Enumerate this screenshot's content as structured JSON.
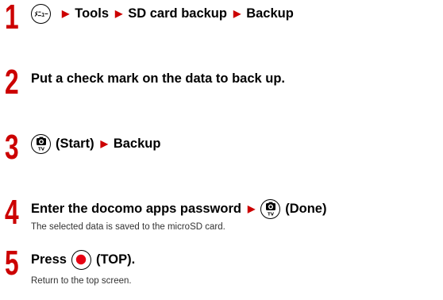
{
  "steps": [
    {
      "number": "1",
      "icon": "menu-key-icon",
      "key_label": "ﾒﾆｭｰ",
      "items": [
        "Tools",
        "SD card backup",
        "Backup"
      ]
    },
    {
      "number": "2",
      "text": "Put a check mark on the data to back up."
    },
    {
      "number": "3",
      "icon": "camera-tv-key-icon",
      "key_label": "TV",
      "text": "(Start)",
      "item": "Backup"
    },
    {
      "number": "4",
      "text": "Enter the docomo apps password",
      "icon": "camera-tv-key-icon",
      "key_label": "TV",
      "text_after": "(Done)",
      "note": "The selected data is saved to the microSD card."
    },
    {
      "number": "5",
      "text_before": "Press",
      "icon": "center-key-icon",
      "text_after": "(TOP).",
      "note": "Return to the top screen."
    }
  ],
  "colors": {
    "step_number": "#cc0000",
    "arrow": "#cc0000",
    "center_key": "#e60012"
  }
}
